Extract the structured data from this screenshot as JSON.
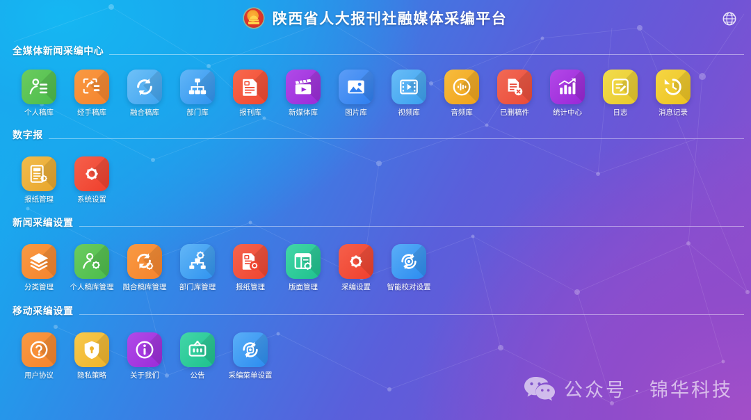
{
  "header": {
    "title": "陕西省人大报刊社融媒体采编平台",
    "emblem_icon": "national-emblem-icon",
    "globe_icon": "globe-icon"
  },
  "sections": [
    {
      "title": "全媒体新闻采编中心",
      "tiles": [
        {
          "label": "个人稿库",
          "icon": "user-list-icon",
          "color": "#4bbd4b",
          "color2": "#6ccb5f"
        },
        {
          "label": "经手稿库",
          "icon": "merge-docs-icon",
          "color": "#f5832c",
          "color2": "#f99a43"
        },
        {
          "label": "融合稿库",
          "icon": "sync-refresh-icon",
          "color": "#3fa3f0",
          "color2": "#6fc1f7"
        },
        {
          "label": "部门库",
          "icon": "org-chart-icon",
          "color": "#2f93ef",
          "color2": "#62b6f7"
        },
        {
          "label": "报刊库",
          "icon": "news-document-icon",
          "color": "#f2472f",
          "color2": "#f7694e"
        },
        {
          "label": "新媒体库",
          "icon": "clapperboard-icon",
          "color": "#9b2bd8",
          "color2": "#b04ae8"
        },
        {
          "label": "图片库",
          "icon": "image-icon",
          "color": "#2e7ff0",
          "color2": "#5c9df6"
        },
        {
          "label": "视频库",
          "icon": "film-strip-icon",
          "color": "#3aa0ef",
          "color2": "#69bdf7"
        },
        {
          "label": "音频库",
          "icon": "audio-wave-icon",
          "color": "#f0a21a",
          "color2": "#f7bc3d"
        },
        {
          "label": "已删稿件",
          "icon": "document-delete-icon",
          "color": "#ea4a38",
          "color2": "#f26a55"
        },
        {
          "label": "统计中心",
          "icon": "bar-chart-icon",
          "color": "#9926d6",
          "color2": "#b348e8"
        },
        {
          "label": "日志",
          "icon": "log-note-icon",
          "color": "#e8c92c",
          "color2": "#f2dc4d"
        },
        {
          "label": "消息记录",
          "icon": "history-clock-icon",
          "color": "#edc220",
          "color2": "#f5d644"
        }
      ]
    },
    {
      "title": "数字报",
      "tiles": [
        {
          "label": "报纸管理",
          "icon": "newspaper-settings-icon",
          "color": "#e8a52a",
          "color2": "#f2bc4d"
        },
        {
          "label": "系统设置",
          "icon": "gear-icon",
          "color": "#ef3f2c",
          "color2": "#f5604b"
        }
      ]
    },
    {
      "title": "新闻采编设置",
      "tiles": [
        {
          "label": "分类管理",
          "icon": "layers-icon",
          "color": "#f5832c",
          "color2": "#f99a43"
        },
        {
          "label": "个人稿库管理",
          "icon": "user-settings-icon",
          "color": "#4bbd4b",
          "color2": "#6ccb5f"
        },
        {
          "label": "融合稿库管理",
          "icon": "sync-settings-icon",
          "color": "#f5832c",
          "color2": "#f99a43"
        },
        {
          "label": "部门库管理",
          "icon": "org-settings-icon",
          "color": "#2f93ef",
          "color2": "#62b6f7"
        },
        {
          "label": "报纸管理",
          "icon": "document-settings-icon",
          "color": "#ef4430",
          "color2": "#f5654e"
        },
        {
          "label": "版面管理",
          "icon": "layout-settings-icon",
          "color": "#1ec28d",
          "color2": "#43d6a8"
        },
        {
          "label": "采编设置",
          "icon": "gear-icon",
          "color": "#ef3f2c",
          "color2": "#f5604b"
        },
        {
          "label": "智能校对设置",
          "icon": "proofread-target-icon",
          "color": "#2b8cf0",
          "color2": "#5aaef7"
        }
      ]
    },
    {
      "title": "移动采编设置",
      "tiles": [
        {
          "label": "用户协议",
          "icon": "question-mark-icon",
          "color": "#f5832c",
          "color2": "#f99a43"
        },
        {
          "label": "隐私策略",
          "icon": "shield-lock-icon",
          "color": "#f0b32a",
          "color2": "#f7c94d"
        },
        {
          "label": "关于我们",
          "icon": "info-icon",
          "color": "#9b2bd8",
          "color2": "#b04ae8"
        },
        {
          "label": "公告",
          "icon": "announce-board-icon",
          "color": "#1ec28d",
          "color2": "#43d6a8"
        },
        {
          "label": "采编菜单设置",
          "icon": "menu-target-icon",
          "color": "#2b8cf0",
          "color2": "#5aaef7"
        }
      ]
    }
  ],
  "watermark": {
    "text": "公众号 · 锦华科技",
    "icon": "wechat-icon"
  },
  "theme": {
    "bg_top_left": "#12b9f3",
    "bg_mid": "#5a5fdb",
    "bg_bottom_right": "#a14ac9",
    "text_on_bg": "#ffffff"
  }
}
